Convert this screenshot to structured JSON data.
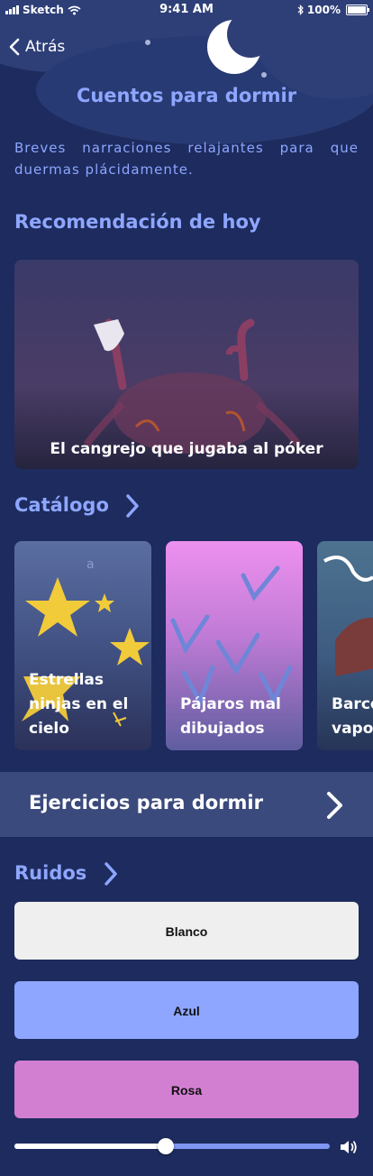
{
  "status_bar": {
    "carrier": "Sketch",
    "time": "9:41 AM",
    "battery": "100%"
  },
  "nav": {
    "back_label": "Atrás"
  },
  "header": {
    "title": "Cuentos para dormir",
    "subtitle": "Breves narraciones relajantes para que duermas plácidamente."
  },
  "recommendation": {
    "section_title": "Recomendación de hoy",
    "card_title": "El cangrejo que jugaba al póker"
  },
  "catalog": {
    "section_title": "Catálogo",
    "items": [
      {
        "label": "Estrellas ninjas en el cielo"
      },
      {
        "label": "Pájaros mal dibujados"
      },
      {
        "label": "Barco de vapor"
      }
    ]
  },
  "exercises": {
    "label": "Ejercicios para dormir"
  },
  "noises": {
    "section_title": "Ruidos",
    "buttons": [
      {
        "label": "Blanco",
        "color": "#efefef"
      },
      {
        "label": "Azul",
        "color": "#8ea6ff"
      },
      {
        "label": "Rosa",
        "color": "#d27fd2"
      }
    ],
    "volume": 0.48
  },
  "colors": {
    "background": "#1d2b5e",
    "accent": "#8ea6ff"
  }
}
